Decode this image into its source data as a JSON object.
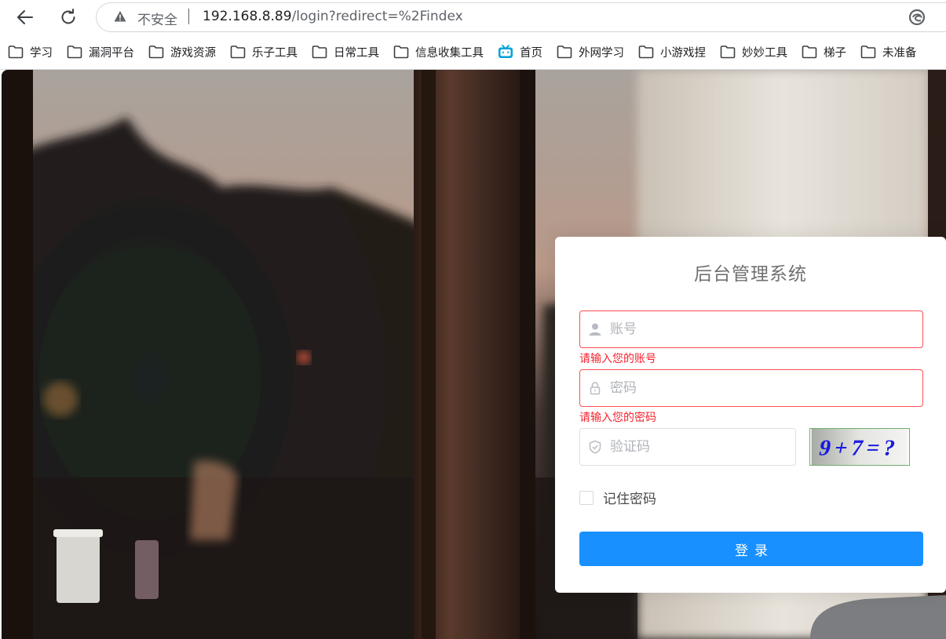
{
  "browser": {
    "insecure_label": "不安全",
    "url_host": "192.168.8.89",
    "url_path": "/login?redirect=%2Findex"
  },
  "bookmarks": [
    {
      "label": "学习",
      "icon": "folder-icon"
    },
    {
      "label": "漏洞平台",
      "icon": "folder-icon"
    },
    {
      "label": "游戏资源",
      "icon": "folder-icon"
    },
    {
      "label": "乐子工具",
      "icon": "folder-icon"
    },
    {
      "label": "日常工具",
      "icon": "folder-icon"
    },
    {
      "label": "信息收集工具",
      "icon": "folder-icon"
    },
    {
      "label": "首页",
      "icon": "bilibili-icon"
    },
    {
      "label": "外网学习",
      "icon": "folder-icon"
    },
    {
      "label": "小游戏捏",
      "icon": "folder-icon"
    },
    {
      "label": "妙妙工具",
      "icon": "folder-icon"
    },
    {
      "label": "梯子",
      "icon": "folder-icon"
    },
    {
      "label": "未准备",
      "icon": "folder-icon"
    }
  ],
  "login": {
    "title": "后台管理系统",
    "username": {
      "placeholder": "账号",
      "value": "",
      "error": "请输入您的账号"
    },
    "password": {
      "placeholder": "密码",
      "value": "",
      "error": "请输入您的密码"
    },
    "captcha": {
      "placeholder": "验证码",
      "value": "",
      "image_text": "9+7=?"
    },
    "remember_label": "记住密码",
    "remember_checked": false,
    "submit_label": "登录"
  },
  "colors": {
    "primary": "#1890ff",
    "error": "#f5222d",
    "captcha_text": "#1a1ae0"
  }
}
